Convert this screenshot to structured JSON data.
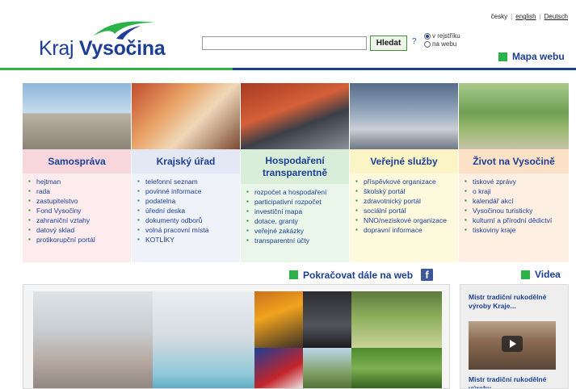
{
  "brand": {
    "name_part1": "Kraj",
    "name_part2": "Vysočina",
    "accent_green": "#2bb34a",
    "accent_navy": "#1c3f95"
  },
  "languages": [
    {
      "label": "česky",
      "active": false
    },
    {
      "label": "english",
      "active": true
    },
    {
      "label": "Deutsch",
      "active": true
    }
  ],
  "search": {
    "placeholder": "",
    "button_label": "Hledat",
    "help_label": "?",
    "scope_options": [
      {
        "label": "v rejstříku",
        "selected": true
      },
      {
        "label": "na webu",
        "selected": false
      }
    ]
  },
  "sitemap_label": "Mapa webu",
  "categories": [
    {
      "title": "Samospráva",
      "items": [
        "hejtman",
        "rada",
        "zastupitelstvo",
        "Fond Vysočiny",
        "zahraniční vztahy",
        "datový sklad",
        "protikorupční portál"
      ]
    },
    {
      "title": "Krajský úřad",
      "items": [
        "telefonní seznam",
        "povinné informace",
        "podatelna",
        "úřední deska",
        "dokumenty odborů",
        "volná pracovní místa",
        "KOTLÍKY"
      ]
    },
    {
      "title": "Hospodaření transparentně",
      "items": [
        "rozpočet a hospodaření",
        "participativní rozpočet",
        "investiční mapa",
        "dotace, granty",
        "veřejné zakázky",
        "transparentní účty"
      ]
    },
    {
      "title": "Veřejné služby",
      "items": [
        "příspěvkové organizace",
        "školský portál",
        "zdravotnický portál",
        "sociální portál",
        "NNO/neziskové organizace",
        "dopravní informace"
      ]
    },
    {
      "title": "Život na Vysočině",
      "items": [
        "tiskové zprávy",
        "o kraji",
        "kalendář akcí",
        "Vysočinou turisticky",
        "kulturní a přírodní dědictví",
        "tiskoviny kraje"
      ]
    }
  ],
  "continue_label": "Pokračovat dále na web",
  "facebook_glyph": "f",
  "videos": {
    "heading": "Videa",
    "items": [
      {
        "title": "Mistr tradiční rukodělné výroby Kraje..."
      },
      {
        "title": "Mistr tradiční rukodělné výroby"
      }
    ]
  }
}
